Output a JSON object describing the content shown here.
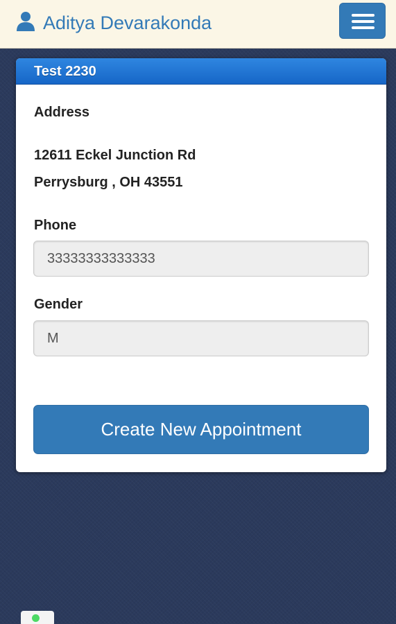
{
  "header": {
    "user_icon": "person-icon",
    "user_name": "Aditya Devarakonda",
    "menu_icon": "hamburger-menu-icon"
  },
  "card": {
    "title": "Test 2230",
    "address": {
      "label": "Address",
      "line1": "12611 Eckel Junction Rd",
      "line2": "Perrysburg , OH 43551"
    },
    "phone": {
      "label": "Phone",
      "value": "33333333333333"
    },
    "gender": {
      "label": "Gender",
      "value": "M"
    },
    "create_appointment_label": "Create New Appointment"
  },
  "colors": {
    "accent": "#337ab7",
    "card_header": "#1f74d4",
    "header_bg": "#fbf6e6",
    "page_bg": "#2b3a5c",
    "status_dot": "#4cd964"
  }
}
